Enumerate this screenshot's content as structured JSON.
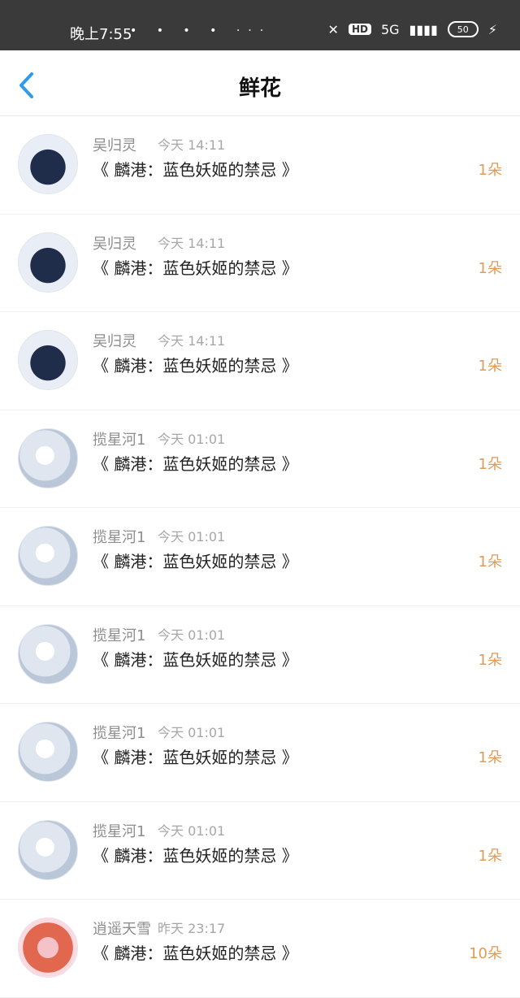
{
  "status_bar": {
    "time": "晚上7:55",
    "left_icons": "• • • • ···",
    "network": "5G",
    "battery": "50"
  },
  "header": {
    "title": "鲜花"
  },
  "rows": [
    {
      "name": "吴归灵",
      "time": "今天 14:11",
      "book": "《 麟港：蓝色妖姬的禁忌 》",
      "qty": "1朵",
      "avatar": "type-a"
    },
    {
      "name": "吴归灵",
      "time": "今天 14:11",
      "book": "《 麟港：蓝色妖姬的禁忌 》",
      "qty": "1朵",
      "avatar": "type-a"
    },
    {
      "name": "吴归灵",
      "time": "今天 14:11",
      "book": "《 麟港：蓝色妖姬的禁忌 》",
      "qty": "1朵",
      "avatar": "type-a"
    },
    {
      "name": "揽星河1",
      "time": "今天 01:01",
      "book": "《 麟港：蓝色妖姬的禁忌 》",
      "qty": "1朵",
      "avatar": "type-b"
    },
    {
      "name": "揽星河1",
      "time": "今天 01:01",
      "book": "《 麟港：蓝色妖姬的禁忌 》",
      "qty": "1朵",
      "avatar": "type-b"
    },
    {
      "name": "揽星河1",
      "time": "今天 01:01",
      "book": "《 麟港：蓝色妖姬的禁忌 》",
      "qty": "1朵",
      "avatar": "type-b"
    },
    {
      "name": "揽星河1",
      "time": "今天 01:01",
      "book": "《 麟港：蓝色妖姬的禁忌 》",
      "qty": "1朵",
      "avatar": "type-b"
    },
    {
      "name": "揽星河1",
      "time": "今天 01:01",
      "book": "《 麟港：蓝色妖姬的禁忌 》",
      "qty": "1朵",
      "avatar": "type-b"
    },
    {
      "name": "逍遥天雪",
      "time": "昨天 23:17",
      "book": "《 麟港：蓝色妖姬的禁忌 》",
      "qty": "10朵",
      "avatar": "type-c"
    }
  ]
}
